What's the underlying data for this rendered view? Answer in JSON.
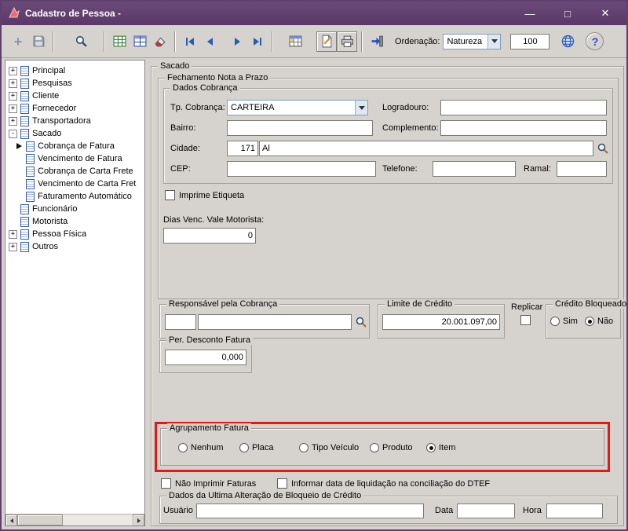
{
  "window": {
    "title": "Cadastro de Pessoa -"
  },
  "icons": {
    "minimize": "—",
    "maximize": "□",
    "close": "✕",
    "plus": "+"
  },
  "toolbar": {
    "ordenacao_label": "Ordenação:",
    "ordenacao_value": "Natureza",
    "record_count": "100"
  },
  "tree": {
    "items": [
      {
        "label": "Principal",
        "expander": "+"
      },
      {
        "label": "Pesquisas",
        "expander": "+"
      },
      {
        "label": "Cliente",
        "expander": "+"
      },
      {
        "label": "Fornecedor",
        "expander": "+"
      },
      {
        "label": "Transportadora",
        "expander": "+"
      },
      {
        "label": "Sacado",
        "expander": "-"
      },
      {
        "label": "Cobrança de Fatura",
        "selected": true
      },
      {
        "label": "Vencimento de Fatura"
      },
      {
        "label": "Cobrança de Carta Frete"
      },
      {
        "label": "Vencimento de Carta Fret"
      },
      {
        "label": "Faturamento Automático"
      },
      {
        "label": "Funcionário"
      },
      {
        "label": "Motorista"
      },
      {
        "label": "Pessoa Física",
        "expander": "+"
      },
      {
        "label": "Outros",
        "expander": "+"
      }
    ]
  },
  "form": {
    "group_title": "Sacado",
    "fechamento": {
      "title": "Fechamento Nota a Prazo",
      "dados_cobranca": {
        "title": "Dados Cobrança",
        "tp_cobranca_label": "Tp. Cobrança:",
        "tp_cobranca_value": "CARTEIRA",
        "logradouro_label": "Logradouro:",
        "logradouro_value": "",
        "bairro_label": "Bairro:",
        "bairro_value": "",
        "complemento_label": "Complemento:",
        "complemento_value": "",
        "cidade_label": "Cidade:",
        "cidade_code": "171",
        "cidade_value": "Al",
        "cep_label": "CEP:",
        "cep_value": "",
        "telefone_label": "Telefone:",
        "telefone_value": "",
        "ramal_label": "Ramal:",
        "ramal_value": ""
      },
      "imprime_etiqueta_label": "Imprime Etiqueta",
      "imprime_etiqueta_checked": false,
      "dias_venc_label": "Dias Venc. Vale Motorista:",
      "dias_venc_value": "0"
    },
    "responsavel": {
      "title": "Responsável pela Cobrança",
      "code": "",
      "name": ""
    },
    "limite": {
      "title": "Limite de Crédito",
      "value": "20.001.097,00"
    },
    "replicar_label": "Replicar",
    "replicar_checked": false,
    "credito_bloqueado": {
      "title": "Crédito Bloqueado",
      "options": [
        {
          "label": "Sim",
          "selected": false
        },
        {
          "label": "Não",
          "selected": true
        }
      ]
    },
    "per_desconto": {
      "title": "Per. Desconto Fatura",
      "value": "0,000"
    },
    "agrupamento": {
      "title": "Agrupamento Fatura",
      "options": [
        {
          "label": "Nenhum",
          "selected": false
        },
        {
          "label": "Placa",
          "selected": false
        },
        {
          "label": "Tipo Veículo",
          "selected": false
        },
        {
          "label": "Produto",
          "selected": false
        },
        {
          "label": "Item",
          "selected": true
        }
      ]
    },
    "nao_imprimir_label": "Não Imprimir Faturas",
    "nao_imprimir_checked": false,
    "informar_data_label": "Informar data de liquidação na conciliação do DTEF",
    "informar_data_checked": false,
    "ultima_alteracao": {
      "title": "Dados da Ultima Alteração de Bloqueio de Crédito",
      "usuario_label": "Usuário",
      "usuario_value": "",
      "data_label": "Data",
      "data_value": "",
      "hora_label": "Hora",
      "hora_value": ""
    }
  }
}
